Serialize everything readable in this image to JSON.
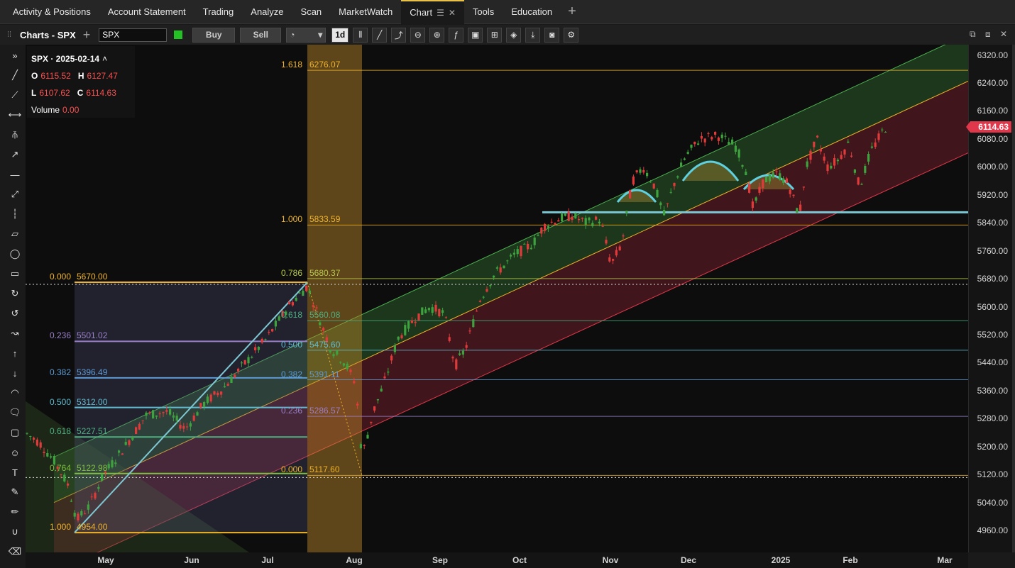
{
  "nav": {
    "tabs": [
      "Activity & Positions",
      "Account Statement",
      "Trading",
      "Analyze",
      "Scan",
      "MarketWatch",
      "Chart",
      "Tools",
      "Education"
    ],
    "active_tab": "Chart"
  },
  "toolbar": {
    "title": "Charts - SPX",
    "symbol": "SPX",
    "buy_label": "Buy",
    "sell_label": "Sell",
    "period": "1d"
  },
  "ohlc": {
    "title": "SPX · 2025-02-14",
    "open_label": "O",
    "open": "6115.52",
    "high_label": "H",
    "high": "6127.47",
    "low_label": "L",
    "low": "6107.62",
    "close_label": "C",
    "close": "6114.63",
    "volume_label": "Volume",
    "volume": "0.00"
  },
  "price_axis": [
    "6320.00",
    "6240.00",
    "6160.00",
    "6080.00",
    "6000.00",
    "5920.00",
    "5840.00",
    "5760.00",
    "5680.00",
    "5600.00",
    "5520.00",
    "5440.00",
    "5360.00",
    "5280.00",
    "5200.00",
    "5120.00",
    "5040.00",
    "4960.00"
  ],
  "current_price": "6114.63",
  "time_axis": [
    "May",
    "Jun",
    "Jul",
    "Aug",
    "Sep",
    "Oct",
    "Nov",
    "Dec",
    "2025",
    "Jan",
    "Feb",
    "Mar"
  ],
  "fib_upper": [
    {
      "ratio": "1.618",
      "price": "6276.07"
    },
    {
      "ratio": "1.000",
      "price": "5833.59"
    },
    {
      "ratio": "0.786",
      "price": "5680.37"
    },
    {
      "ratio": "0.618",
      "price": "5560.08"
    },
    {
      "ratio": "0.500",
      "price": "5475.60"
    },
    {
      "ratio": "0.382",
      "price": "5391.11"
    },
    {
      "ratio": "0.236",
      "price": "5286.57"
    },
    {
      "ratio": "0.000",
      "price": "5117.60"
    }
  ],
  "fib_lower": [
    {
      "ratio": "0.000",
      "price": "5670.00"
    },
    {
      "ratio": "0.236",
      "price": "5501.02"
    },
    {
      "ratio": "0.382",
      "price": "5396.49"
    },
    {
      "ratio": "0.500",
      "price": "5312.00"
    },
    {
      "ratio": "0.618",
      "price": "5227.51"
    },
    {
      "ratio": "0.764",
      "price": "5122.98"
    },
    {
      "ratio": "1.000",
      "price": "4954.00"
    }
  ],
  "colors": {
    "up": "#3ea33e",
    "down": "#e03a3a",
    "fib": "#e8a53a",
    "channel_green": "#2f6b2f",
    "channel_red": "#6b1f2a",
    "support": "#7ec8d4"
  }
}
